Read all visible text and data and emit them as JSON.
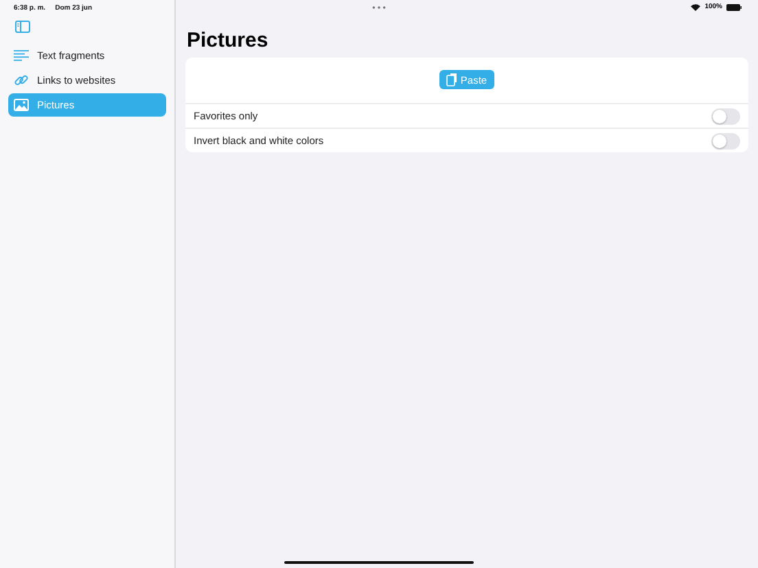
{
  "status_bar": {
    "time": "6:38 p. m.",
    "date": "Dom 23 jun",
    "battery": "100%"
  },
  "sidebar": {
    "items": [
      {
        "kind": "text",
        "label": "Text fragments",
        "selected": false
      },
      {
        "kind": "link",
        "label": "Links to websites",
        "selected": false
      },
      {
        "kind": "picture",
        "label": "Pictures",
        "selected": true
      }
    ]
  },
  "main": {
    "title": "Pictures",
    "paste_button": "Paste",
    "toggles": [
      {
        "label": "Favorites only",
        "on": false
      },
      {
        "label": "Invert black and white colors",
        "on": false
      }
    ]
  }
}
